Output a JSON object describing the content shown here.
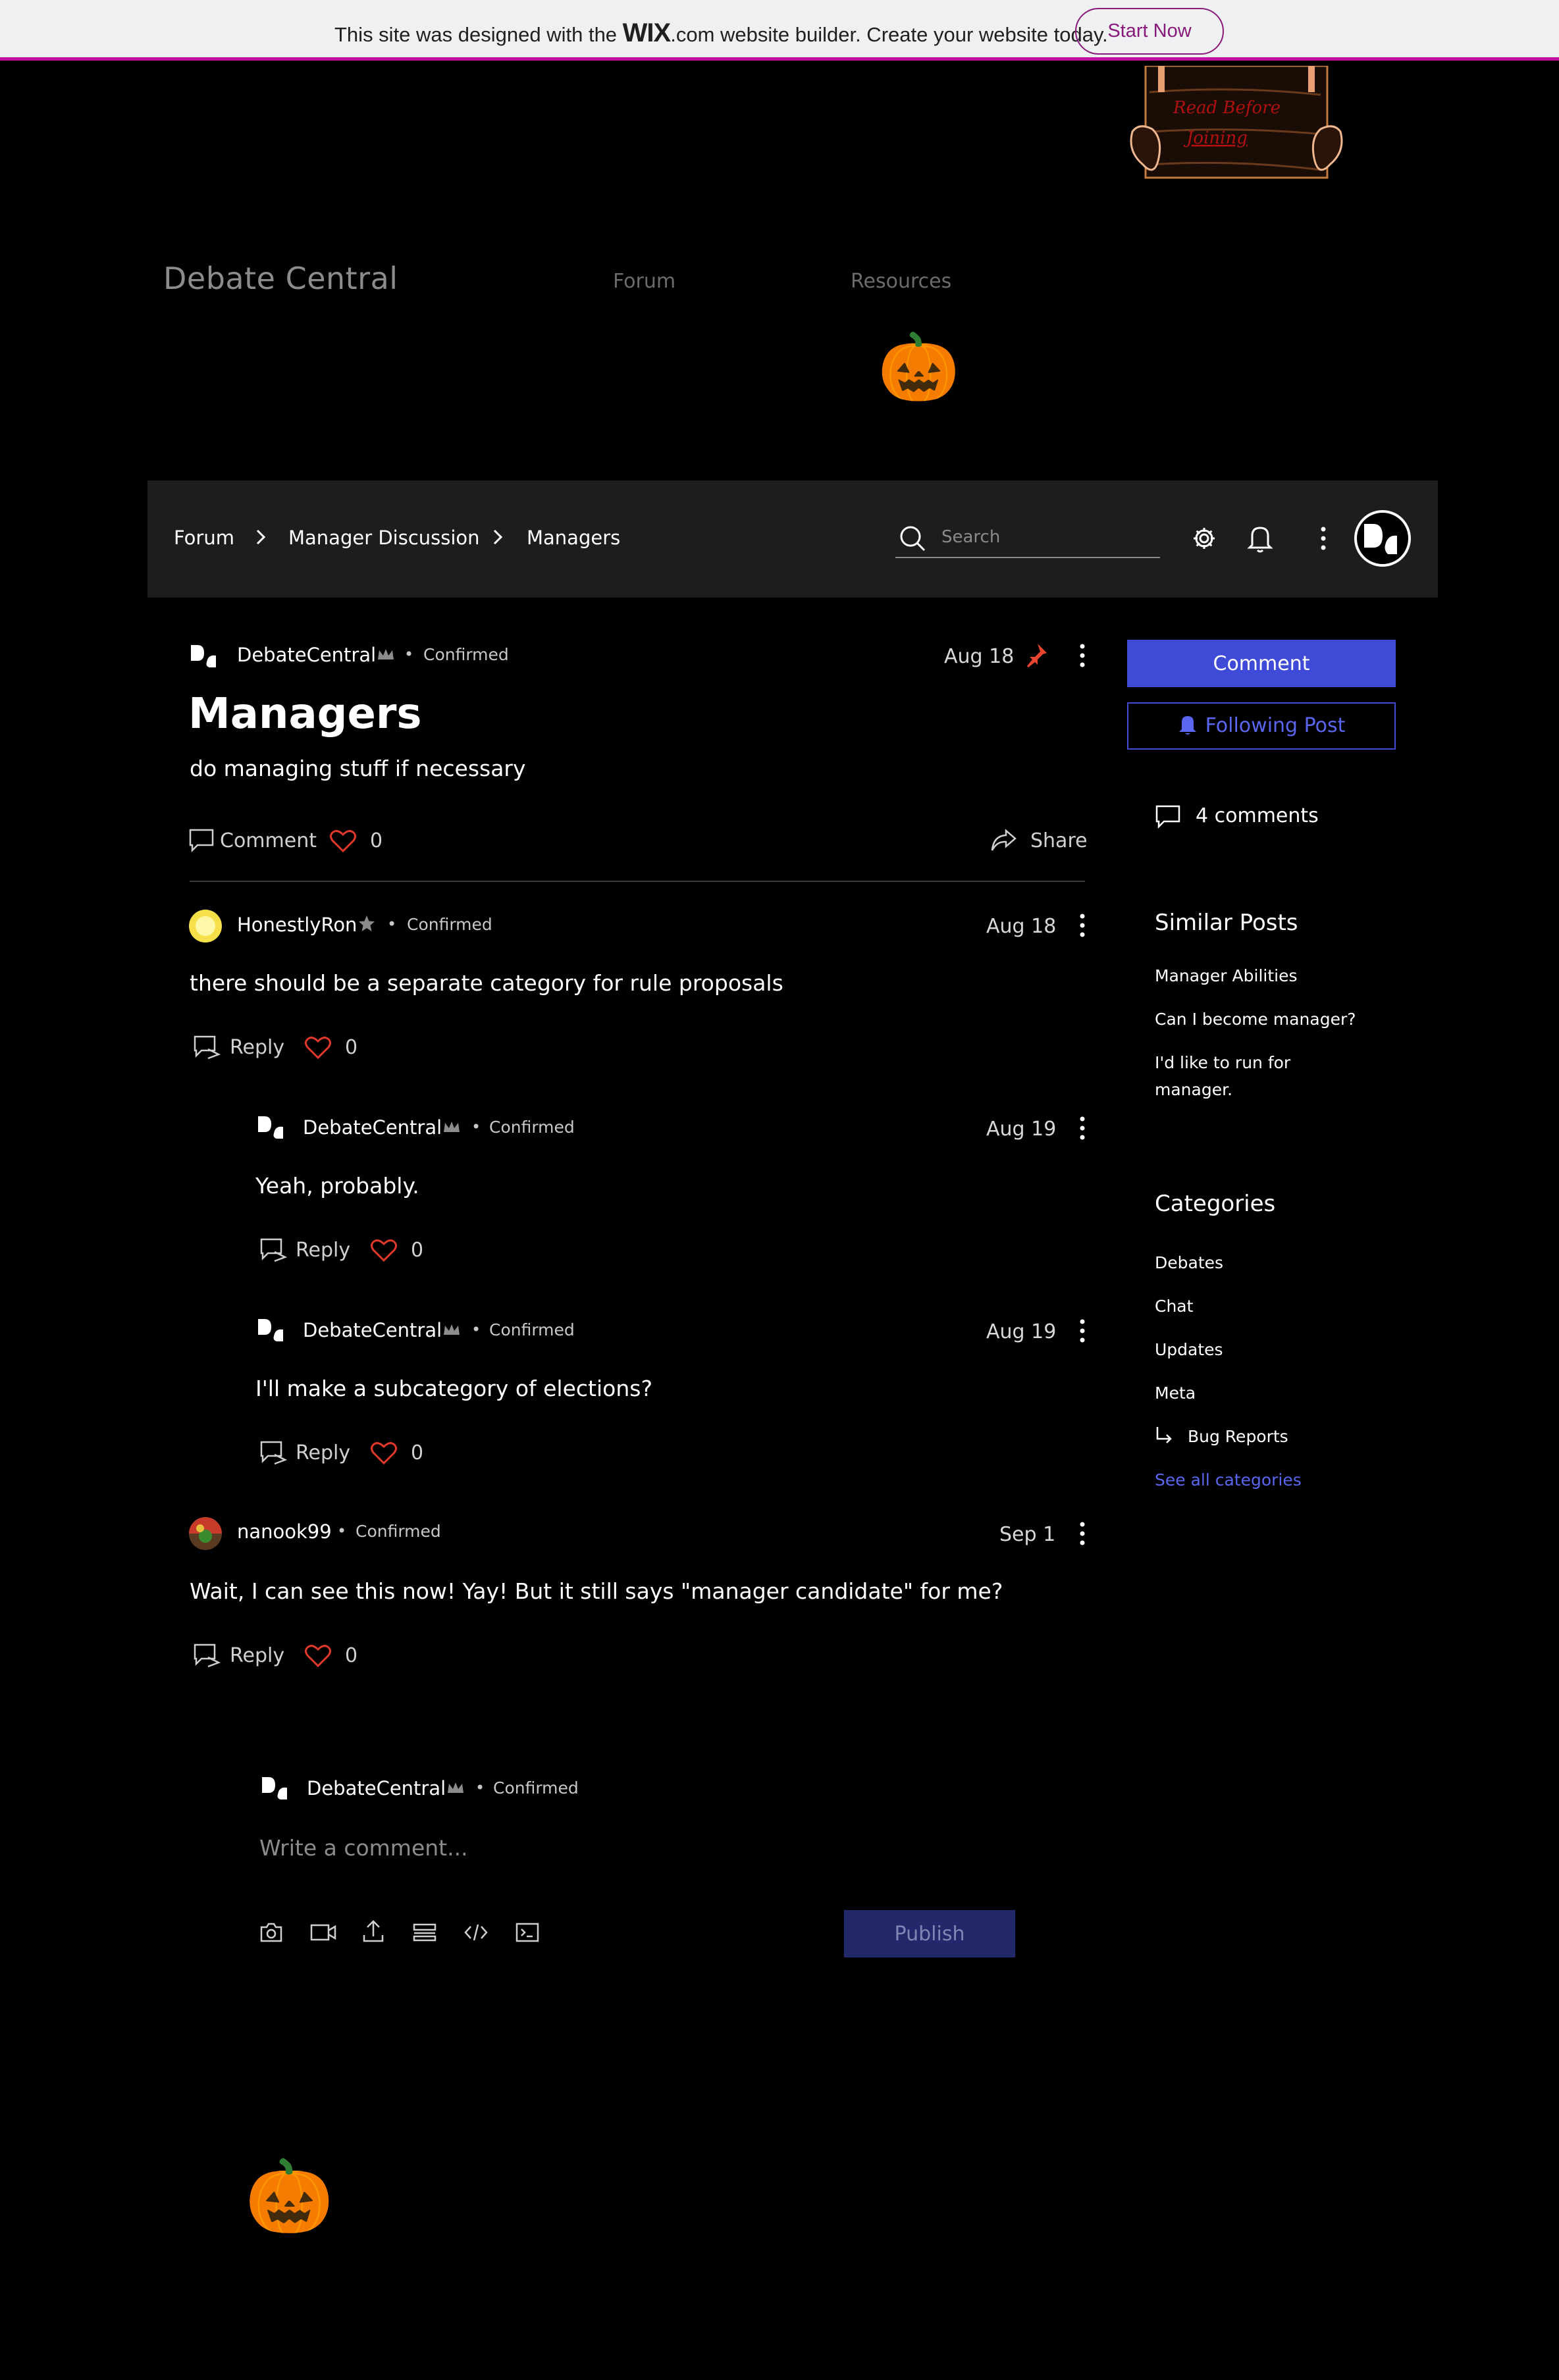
{
  "wix_banner": {
    "text_before": "This site was designed with the ",
    "logo": "WIX",
    "text_after": ".com website builder. Create your website today.",
    "button": "Start Now"
  },
  "sign": {
    "line1": "Read Before",
    "line2": "Joining"
  },
  "site": {
    "title": "Debate Central",
    "nav": [
      "Forum",
      "Resources"
    ],
    "pumpkin": "🎃"
  },
  "breadcrumb": [
    "Forum",
    "Manager Discussion",
    "Managers"
  ],
  "search": {
    "placeholder": "Search"
  },
  "icons": {
    "search": "search-icon",
    "settings": "gear-icon",
    "notifications": "bell-icon",
    "more": "more-vertical-icon",
    "pin": "pin-icon",
    "heart": "heart-icon",
    "reply": "reply-icon",
    "comment": "comment-icon",
    "share": "share-icon",
    "crown": "crown-icon",
    "star": "star-icon"
  },
  "colors": {
    "accent": "#3f4bd6",
    "pin": "#e8452e",
    "heart": "#e0392b",
    "banner_accent": "#c20fa0"
  },
  "post": {
    "author": "DebateCentral",
    "status": "Confirmed",
    "date": "Aug 18",
    "title": "Managers",
    "body": "do managing stuff if necessary",
    "comment_label": "Comment",
    "likes": "0",
    "share_label": "Share"
  },
  "comments": [
    {
      "author": "HonestlyRon",
      "status": "Confirmed",
      "date": "Aug 18",
      "text": "there should be a separate category for rule proposals",
      "reply": "Reply",
      "likes": "0"
    },
    {
      "author": "DebateCentral",
      "status": "Confirmed",
      "date": "Aug 19",
      "text": "Yeah, probably.",
      "reply": "Reply",
      "likes": "0"
    },
    {
      "author": "DebateCentral",
      "status": "Confirmed",
      "date": "Aug 19",
      "text": "I'll make a subcategory of elections?",
      "reply": "Reply",
      "likes": "0"
    },
    {
      "author": "nanook99",
      "status": "Confirmed",
      "date": "Sep 1",
      "text": "Wait, I can see this now! Yay! But it still says \"manager candidate\" for me?",
      "reply": "Reply",
      "likes": "0"
    }
  ],
  "editor": {
    "author": "DebateCentral",
    "status": "Confirmed",
    "placeholder": "Write a comment...",
    "publish": "Publish"
  },
  "sidebar": {
    "comment_button": "Comment",
    "following_button": "Following Post",
    "comments_count": "4 comments",
    "similar_title": "Similar Posts",
    "similar": [
      "Manager Abilities",
      "Can I become manager?",
      "I'd like to run for",
      "manager."
    ],
    "categories_title": "Categories",
    "categories": [
      "Debates",
      "Chat",
      "Updates",
      "Meta",
      "Bug Reports"
    ],
    "see_all": "See all categories"
  }
}
